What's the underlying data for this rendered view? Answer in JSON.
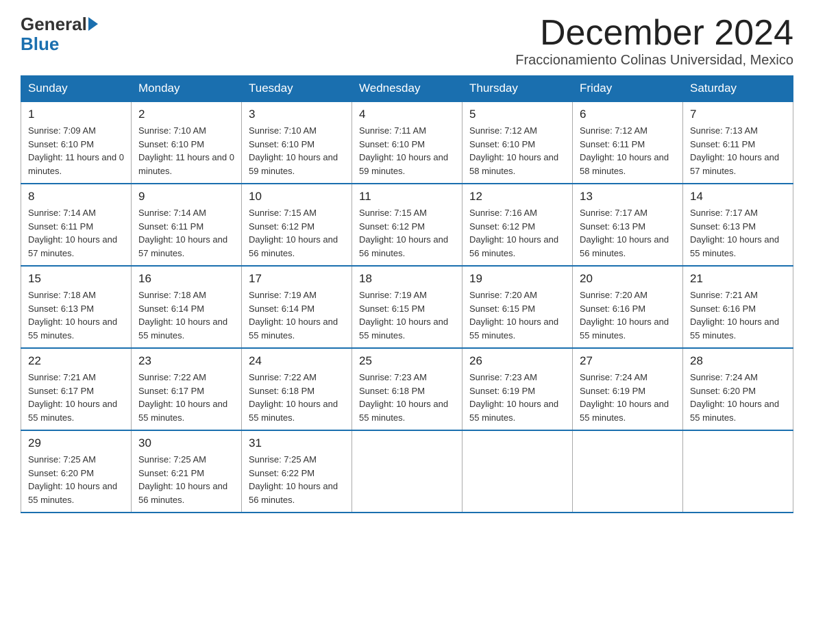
{
  "logo": {
    "text_general": "General",
    "text_blue": "Blue",
    "arrow_color": "#1a6faf"
  },
  "header": {
    "month_title": "December 2024",
    "location": "Fraccionamiento Colinas Universidad, Mexico"
  },
  "days_of_week": [
    "Sunday",
    "Monday",
    "Tuesday",
    "Wednesday",
    "Thursday",
    "Friday",
    "Saturday"
  ],
  "weeks": [
    [
      {
        "day": "1",
        "sunrise": "7:09 AM",
        "sunset": "6:10 PM",
        "daylight": "11 hours and 0 minutes."
      },
      {
        "day": "2",
        "sunrise": "7:10 AM",
        "sunset": "6:10 PM",
        "daylight": "11 hours and 0 minutes."
      },
      {
        "day": "3",
        "sunrise": "7:10 AM",
        "sunset": "6:10 PM",
        "daylight": "10 hours and 59 minutes."
      },
      {
        "day": "4",
        "sunrise": "7:11 AM",
        "sunset": "6:10 PM",
        "daylight": "10 hours and 59 minutes."
      },
      {
        "day": "5",
        "sunrise": "7:12 AM",
        "sunset": "6:10 PM",
        "daylight": "10 hours and 58 minutes."
      },
      {
        "day": "6",
        "sunrise": "7:12 AM",
        "sunset": "6:11 PM",
        "daylight": "10 hours and 58 minutes."
      },
      {
        "day": "7",
        "sunrise": "7:13 AM",
        "sunset": "6:11 PM",
        "daylight": "10 hours and 57 minutes."
      }
    ],
    [
      {
        "day": "8",
        "sunrise": "7:14 AM",
        "sunset": "6:11 PM",
        "daylight": "10 hours and 57 minutes."
      },
      {
        "day": "9",
        "sunrise": "7:14 AM",
        "sunset": "6:11 PM",
        "daylight": "10 hours and 57 minutes."
      },
      {
        "day": "10",
        "sunrise": "7:15 AM",
        "sunset": "6:12 PM",
        "daylight": "10 hours and 56 minutes."
      },
      {
        "day": "11",
        "sunrise": "7:15 AM",
        "sunset": "6:12 PM",
        "daylight": "10 hours and 56 minutes."
      },
      {
        "day": "12",
        "sunrise": "7:16 AM",
        "sunset": "6:12 PM",
        "daylight": "10 hours and 56 minutes."
      },
      {
        "day": "13",
        "sunrise": "7:17 AM",
        "sunset": "6:13 PM",
        "daylight": "10 hours and 56 minutes."
      },
      {
        "day": "14",
        "sunrise": "7:17 AM",
        "sunset": "6:13 PM",
        "daylight": "10 hours and 55 minutes."
      }
    ],
    [
      {
        "day": "15",
        "sunrise": "7:18 AM",
        "sunset": "6:13 PM",
        "daylight": "10 hours and 55 minutes."
      },
      {
        "day": "16",
        "sunrise": "7:18 AM",
        "sunset": "6:14 PM",
        "daylight": "10 hours and 55 minutes."
      },
      {
        "day": "17",
        "sunrise": "7:19 AM",
        "sunset": "6:14 PM",
        "daylight": "10 hours and 55 minutes."
      },
      {
        "day": "18",
        "sunrise": "7:19 AM",
        "sunset": "6:15 PM",
        "daylight": "10 hours and 55 minutes."
      },
      {
        "day": "19",
        "sunrise": "7:20 AM",
        "sunset": "6:15 PM",
        "daylight": "10 hours and 55 minutes."
      },
      {
        "day": "20",
        "sunrise": "7:20 AM",
        "sunset": "6:16 PM",
        "daylight": "10 hours and 55 minutes."
      },
      {
        "day": "21",
        "sunrise": "7:21 AM",
        "sunset": "6:16 PM",
        "daylight": "10 hours and 55 minutes."
      }
    ],
    [
      {
        "day": "22",
        "sunrise": "7:21 AM",
        "sunset": "6:17 PM",
        "daylight": "10 hours and 55 minutes."
      },
      {
        "day": "23",
        "sunrise": "7:22 AM",
        "sunset": "6:17 PM",
        "daylight": "10 hours and 55 minutes."
      },
      {
        "day": "24",
        "sunrise": "7:22 AM",
        "sunset": "6:18 PM",
        "daylight": "10 hours and 55 minutes."
      },
      {
        "day": "25",
        "sunrise": "7:23 AM",
        "sunset": "6:18 PM",
        "daylight": "10 hours and 55 minutes."
      },
      {
        "day": "26",
        "sunrise": "7:23 AM",
        "sunset": "6:19 PM",
        "daylight": "10 hours and 55 minutes."
      },
      {
        "day": "27",
        "sunrise": "7:24 AM",
        "sunset": "6:19 PM",
        "daylight": "10 hours and 55 minutes."
      },
      {
        "day": "28",
        "sunrise": "7:24 AM",
        "sunset": "6:20 PM",
        "daylight": "10 hours and 55 minutes."
      }
    ],
    [
      {
        "day": "29",
        "sunrise": "7:25 AM",
        "sunset": "6:20 PM",
        "daylight": "10 hours and 55 minutes."
      },
      {
        "day": "30",
        "sunrise": "7:25 AM",
        "sunset": "6:21 PM",
        "daylight": "10 hours and 56 minutes."
      },
      {
        "day": "31",
        "sunrise": "7:25 AM",
        "sunset": "6:22 PM",
        "daylight": "10 hours and 56 minutes."
      },
      null,
      null,
      null,
      null
    ]
  ],
  "labels": {
    "sunrise_prefix": "Sunrise: ",
    "sunset_prefix": "Sunset: ",
    "daylight_prefix": "Daylight: "
  }
}
